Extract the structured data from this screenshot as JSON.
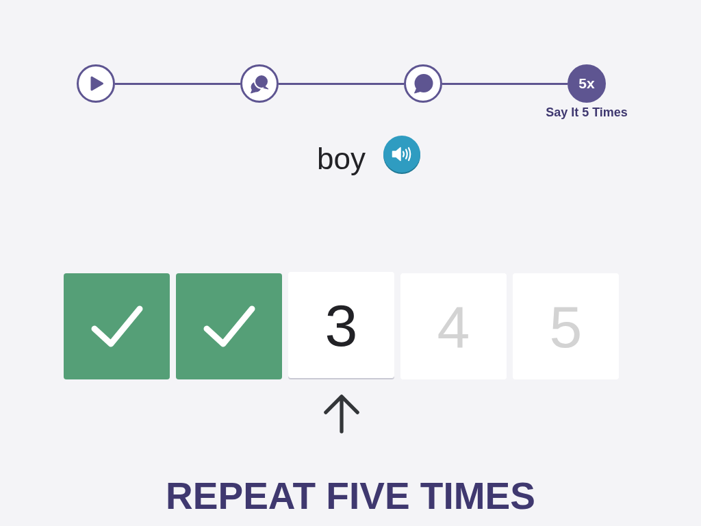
{
  "progress_steps": [
    {
      "kind": "play",
      "selected": false
    },
    {
      "kind": "chat",
      "selected": false
    },
    {
      "kind": "speech",
      "selected": false
    },
    {
      "kind": "count",
      "label": "5x",
      "caption": "Say It 5 Times",
      "selected": true
    }
  ],
  "word": "boy",
  "attempts": [
    {
      "checked": true,
      "selected": false
    },
    {
      "checked": true,
      "selected": false
    },
    {
      "label": "3",
      "checked": false,
      "selected": true
    },
    {
      "label": "4",
      "checked": false,
      "selected": false
    },
    {
      "label": "5",
      "checked": false,
      "selected": false
    }
  ],
  "instruction": "REPEAT FIVE TIMES"
}
